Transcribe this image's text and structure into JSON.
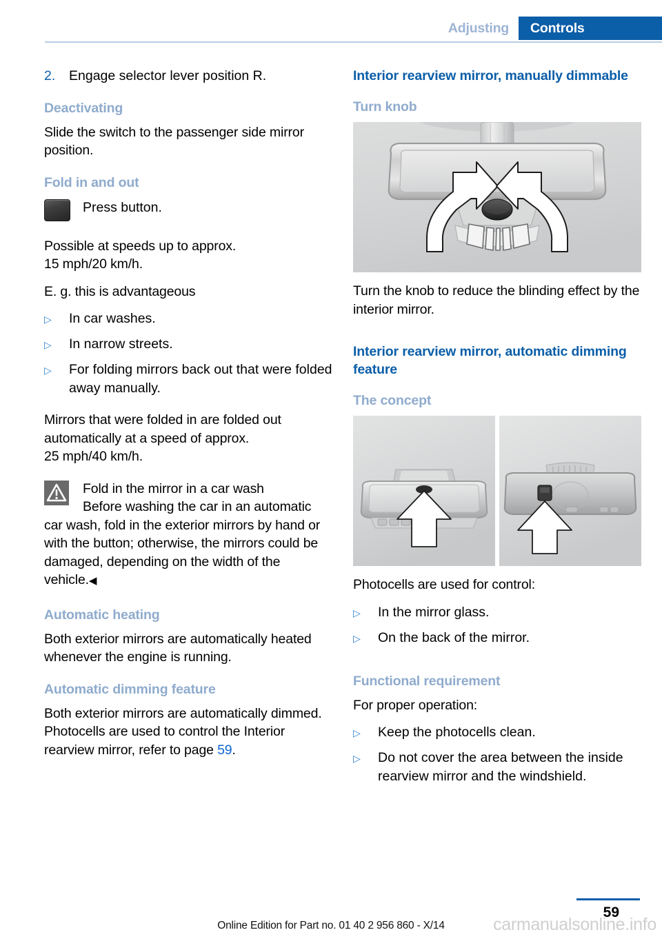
{
  "header": {
    "tab_inactive": "Adjusting",
    "tab_active": "Controls",
    "accent_blue": "#0b5ea8",
    "muted_blue": "#9db4d4"
  },
  "left_column": {
    "step": {
      "number": "2.",
      "text": "Engage selector lever position R."
    },
    "deactivating_heading": "Deactivating",
    "deactivating_text": "Slide the switch to the passenger side mirror position.",
    "fold_heading": "Fold in and out",
    "press_button_label": "Press button.",
    "press_button_icon": "rocker-button-icon",
    "speed_text": "Possible at speeds up to approx.\n15 mph/20 km/h.",
    "advantageous_text": "E. g. this is advantageous",
    "advantageous_bullets": [
      "In car washes.",
      "In narrow streets.",
      "For folding mirrors back out that were folded away manually."
    ],
    "fold_out_text": "Mirrors that were folded in are folded out automatically at a speed of approx.\n25 mph/40 km/h.",
    "warning": {
      "icon": "warning-triangle-icon",
      "title": "Fold in the mirror in a car wash",
      "body": "Before washing the car in an automatic car wash, fold in the exterior mirrors by hand or with the button; otherwise, the mirrors could be damaged, depending on the width of the vehicle.",
      "end_marker": "◀"
    },
    "auto_heating_heading": "Automatic heating",
    "auto_heating_text": "Both exterior mirrors are automatically heated whenever the engine is running.",
    "auto_dimming_heading": "Automatic dimming feature",
    "auto_dimming_text_before": "Both exterior mirrors are automatically dimmed. Photocells are used to control the Interior rearview mirror, refer to page ",
    "auto_dimming_page_link": "59",
    "auto_dimming_text_after": "."
  },
  "right_column": {
    "manual_heading": "Interior rearview mirror, manually dimmable",
    "turn_knob_heading": "Turn knob",
    "figure_turn_knob": "interior-rearview-mirror-turn-knob-illustration",
    "turn_knob_text": "Turn the knob to reduce the blinding effect by the interior mirror.",
    "auto_heading": "Interior rearview mirror, automatic dimming feature",
    "concept_heading": "The concept",
    "figure_photocells": "photocell-locations-illustration",
    "photocells_text": "Photocells are used for control:",
    "photocells_bullets": [
      "In the mirror glass.",
      "On the back of the mirror."
    ],
    "functional_heading": "Functional requirement",
    "functional_text": "For proper operation:",
    "functional_bullets": [
      "Keep the photocells clean.",
      "Do not cover the area between the inside rearview mirror and the windshield."
    ]
  },
  "footer": {
    "page_number": "59",
    "edition_text": "Online Edition for Part no. 01 40 2 956 860 - X/14",
    "watermark": "carmanualsonline.info"
  },
  "bullet_glyph": "▷"
}
